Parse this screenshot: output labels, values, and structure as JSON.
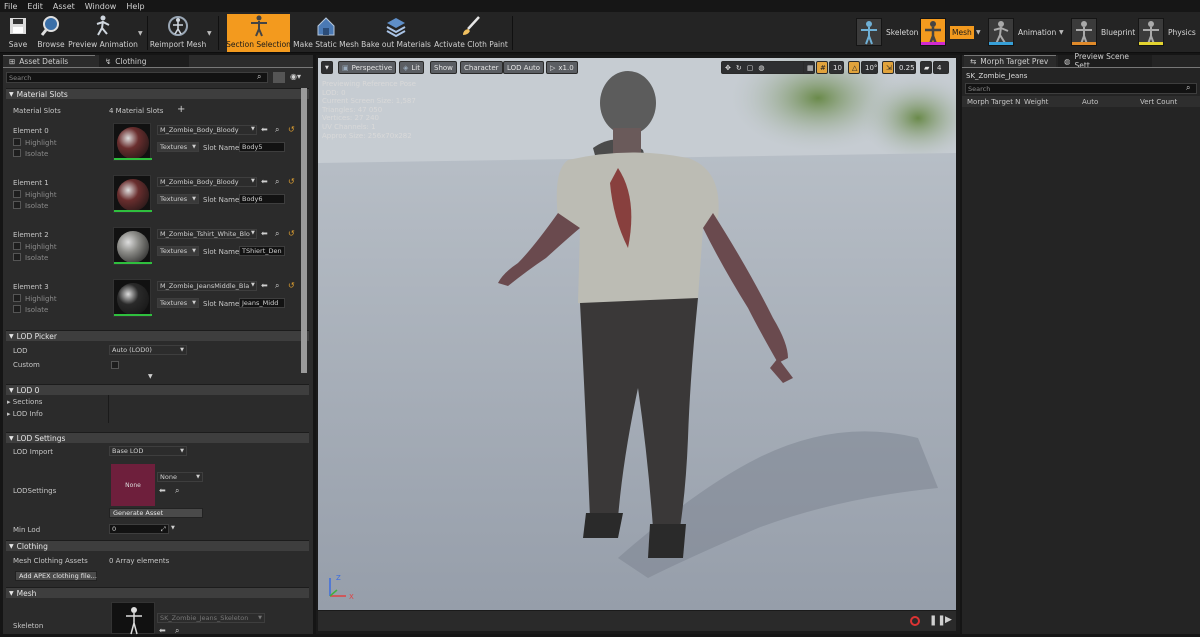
{
  "menu": [
    "File",
    "Edit",
    "Asset",
    "Window",
    "Help"
  ],
  "toolbar": {
    "buttons": [
      "Save",
      "Browse",
      "Preview Animation",
      "Reimport Mesh",
      "Section Selection",
      "Make Static Mesh",
      "Bake out Materials",
      "Activate Cloth Paint"
    ]
  },
  "modes": [
    "Skeleton",
    "Mesh",
    "Animation",
    "Blueprint",
    "Physics"
  ],
  "left": {
    "tabs": [
      "Asset Details",
      "Clothing"
    ],
    "search_placeholder": "Search",
    "material_slots": {
      "title": "Material Slots",
      "label": "Material Slots",
      "count": "4 Material Slots",
      "elements": [
        {
          "name": "Element 0",
          "material": "M_Zombie_Body_Bloody",
          "textures": "Textures",
          "slot_label": "Slot Name",
          "slot": "Body5",
          "color": "#6a2e2e"
        },
        {
          "name": "Element 1",
          "material": "M_Zombie_Body_Bloody",
          "textures": "Textures",
          "slot_label": "Slot Name",
          "slot": "Body6",
          "color": "#6a2e2e"
        },
        {
          "name": "Element 2",
          "material": "M_Zombie_Tshirt_White_Blo",
          "textures": "Textures",
          "slot_label": "Slot Name",
          "slot": "TShiert_Den",
          "color": "#8c8c88"
        },
        {
          "name": "Element 3",
          "material": "M_Zombie_JeansMiddle_Bla",
          "textures": "Textures",
          "slot_label": "Slot Name",
          "slot": "Jeans_Midd",
          "color": "#2a2a2a"
        }
      ],
      "highlight": "Highlight",
      "isolate": "Isolate"
    },
    "lod_picker": {
      "title": "LOD Picker",
      "lod_label": "LOD",
      "lod_value": "Auto (LOD0)",
      "custom_label": "Custom"
    },
    "lod0": {
      "title": "LOD 0",
      "sections": "Sections",
      "lod_info": "LOD Info"
    },
    "lod_settings": {
      "title": "LOD Settings",
      "import_label": "LOD Import",
      "import_value": "Base LOD",
      "settings_label": "LODSettings",
      "thumb_text": "None",
      "none_value": "None",
      "generate": "Generate Asset",
      "min_lod_label": "Min Lod",
      "min_lod_value": "0"
    },
    "clothing": {
      "title": "Clothing",
      "assets_label": "Mesh Clothing Assets",
      "assets_value": "0 Array elements",
      "add_button": "Add APEX clothing file..."
    },
    "mesh": {
      "title": "Mesh",
      "skeleton_label": "Skeleton",
      "skeleton_value": "SK_Zombie_Jeans_Skeleton"
    }
  },
  "viewport": {
    "buttons": [
      "Perspective",
      "Lit",
      "Show",
      "Character",
      "LOD Auto",
      "x1.0"
    ],
    "right_values": [
      "10",
      "10°",
      "0.25",
      "4"
    ],
    "stats": [
      "Previewing Reference Pose",
      "LOD: 0",
      "Current Screen Size: 1,587",
      "Triangles: 47 050",
      "Vertices: 27 240",
      "UV Channels: 1",
      "Approx Size: 256x70x282"
    ],
    "axis": {
      "z": "Z",
      "x": "X"
    }
  },
  "right": {
    "tabs": [
      "Morph Target Prev",
      "Preview Scene Sett"
    ],
    "asset": "SK_Zombie_Jeans",
    "search_placeholder": "Search",
    "columns": [
      "Morph Target N",
      "Weight",
      "Auto",
      "Vert Count"
    ]
  },
  "colors": {
    "accent": "#f39a1e",
    "panel": "#2b2b2b",
    "green": "#2fbf3e"
  }
}
